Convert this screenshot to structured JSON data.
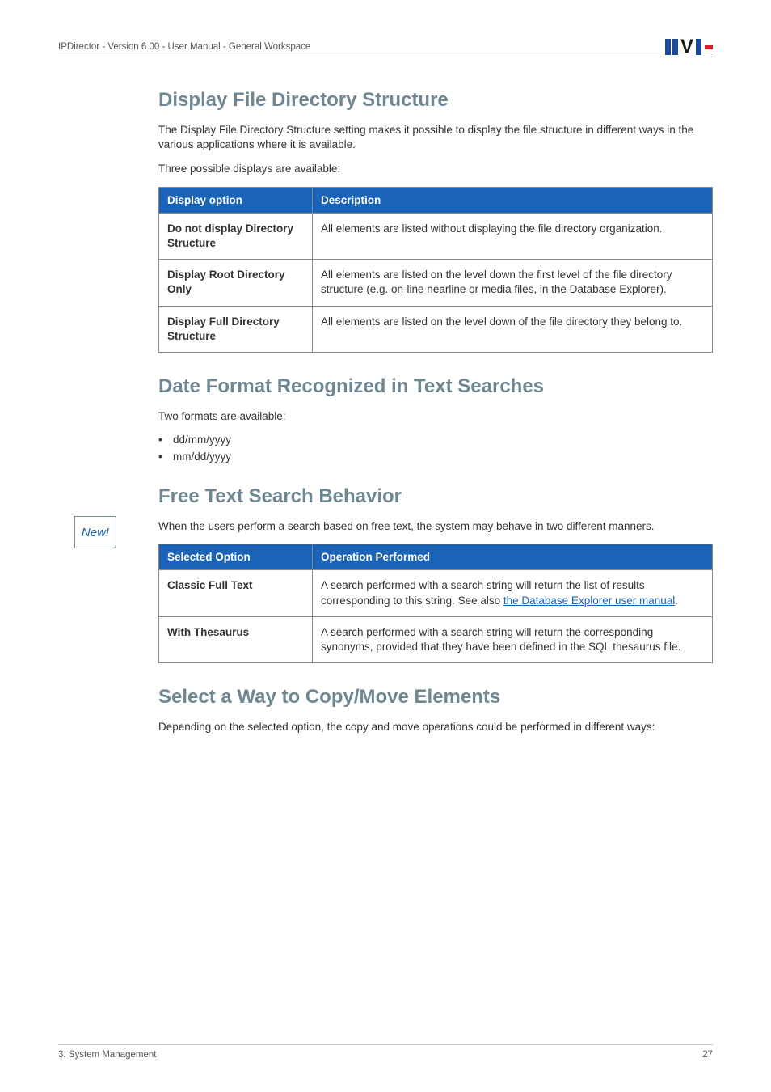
{
  "header": {
    "left": "IPDirector - Version 6.00 - User Manual - General Workspace"
  },
  "sections": {
    "dfds": {
      "title": "Display File Directory Structure",
      "intro": "The Display File Directory Structure setting makes it possible to display the file structure in different ways in the various applications where it is available.",
      "line2": "Three possible displays are available:",
      "table": {
        "head": {
          "c1": "Display option",
          "c2": "Description"
        },
        "rows": [
          {
            "c1": "Do not display Directory Structure",
            "c2": "All elements are listed without displaying the file directory organization."
          },
          {
            "c1": "Display Root Directory Only",
            "c2": "All elements are listed on the level down the first level of the file directory structure (e.g. on-line nearline or media files, in the Database Explorer)."
          },
          {
            "c1": "Display Full Directory Structure",
            "c2": "All elements are listed on the level down of the file directory they belong to."
          }
        ]
      }
    },
    "dfr": {
      "title": "Date Format Recognized in Text Searches",
      "intro": "Two formats are available:",
      "bullets": [
        "dd/mm/yyyy",
        "mm/dd/yyyy"
      ]
    },
    "fts": {
      "title": "Free Text Search Behavior",
      "badge": "New!",
      "intro": "When the users perform a search based on free text, the system may behave in two different manners.",
      "table": {
        "head": {
          "c1": "Selected Option",
          "c2": "Operation Performed"
        },
        "rows": [
          {
            "c1": "Classic Full Text",
            "c2_pre": "A search performed with a search string will return the list of results corresponding to this string. See also ",
            "c2_link": "the Database Explorer user manual",
            "c2_post": "."
          },
          {
            "c1": "With Thesaurus",
            "c2": "A search performed with a search string will return the corresponding synonyms, provided that they have been defined in the SQL thesaurus file."
          }
        ]
      }
    },
    "swcm": {
      "title": "Select a Way to Copy/Move Elements",
      "intro": "Depending on the selected option, the copy and move operations could be performed in different ways:"
    }
  },
  "footer": {
    "left": "3. System Management",
    "right": "27"
  }
}
